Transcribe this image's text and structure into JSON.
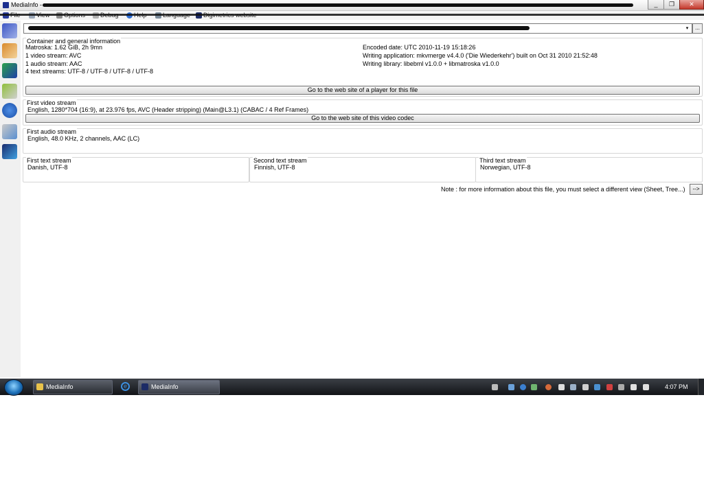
{
  "window": {
    "title": "MediaInfo - "
  },
  "titlebar": {
    "min": "_",
    "max": "❐",
    "close": "✕"
  },
  "menu": [
    "File",
    "View",
    "Options",
    "Debug",
    "Help",
    "Language",
    "Digimetrics website"
  ],
  "combo": {
    "arrow": "▾",
    "browse": "..."
  },
  "general": {
    "label": "Container and general information",
    "left": [
      "Matroska: 1.62 GiB, 2h 9mn",
      "1 video stream: AVC",
      "1 audio stream: AAC",
      "4 text streams: UTF-8 / UTF-8 / UTF-8 / UTF-8"
    ],
    "right": [
      "Encoded date: UTC 2010-11-19 15:18:26",
      "Writing application: mkvmerge v4.4.0 ('Die Wiederkehr') built on Oct 31 2010 21:52:48",
      "Writing library: libebml v1.0.0 + libmatroska v1.0.0"
    ],
    "button": "Go to the web site of a player for this file"
  },
  "video": {
    "label": "First video stream",
    "info": "English, 1280*704 (16:9), at 23.976 fps, AVC (Header stripping) (Main@L3.1) (CABAC / 4 Ref Frames)",
    "button": "Go to the web site of this video codec"
  },
  "audio": {
    "label": "First audio stream",
    "info": "English, 48.0 KHz, 2 channels, AAC (LC)"
  },
  "text_streams": [
    {
      "label": "First text stream",
      "info": "Danish, UTF-8"
    },
    {
      "label": "Second text stream",
      "info": "Finnish, UTF-8"
    },
    {
      "label": "Third text stream",
      "info": "Norwegian, UTF-8"
    }
  ],
  "note": "Note : for more information about this file, you must select a different view (Sheet, Tree...)",
  "next_button": "-->",
  "taskbar": {
    "buttons": [
      "MediaInfo",
      "MediaInfo"
    ],
    "clock": "4:07 PM",
    "ie": "e"
  }
}
